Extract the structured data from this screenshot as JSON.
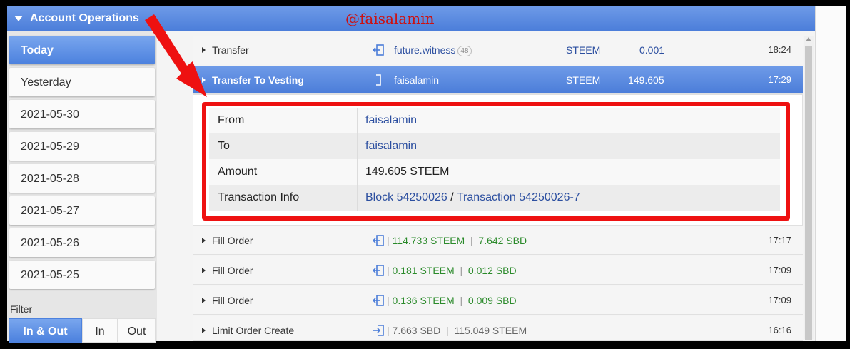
{
  "header": {
    "title": "Account Operations",
    "watermark": "@faisalamin"
  },
  "sidebar": {
    "days": [
      "Today",
      "Yesterday",
      "2021-05-30",
      "2021-05-29",
      "2021-05-28",
      "2021-05-27",
      "2021-05-26",
      "2021-05-25"
    ],
    "active_day": "Today",
    "filter_label": "Filter",
    "filter_options": [
      "In & Out",
      "In",
      "Out"
    ],
    "active_filter": "In & Out"
  },
  "operations": [
    {
      "type": "Transfer",
      "direction": "in",
      "party": "future.witness",
      "badge": "48",
      "asset": "STEEM",
      "amount": "0.001",
      "time": "18:24"
    },
    {
      "type": "Transfer To Vesting",
      "direction": "self",
      "party": "faisalamin",
      "asset": "STEEM",
      "amount": "149.605",
      "time": "17:29",
      "selected": true
    },
    {
      "type": "Fill Order",
      "direction": "in",
      "amount_a": "114.733 STEEM",
      "separator": "|",
      "amount_b": "7.642 SBD",
      "time": "17:17"
    },
    {
      "type": "Fill Order",
      "direction": "in",
      "amount_a": "0.181 STEEM",
      "separator": "|",
      "amount_b": "0.012 SBD",
      "time": "17:09"
    },
    {
      "type": "Fill Order",
      "direction": "in",
      "amount_a": "0.136 STEEM",
      "separator": "|",
      "amount_b": "0.009 SBD",
      "time": "17:09"
    },
    {
      "type": "Limit Order Create",
      "direction": "out",
      "separator": "|",
      "amount_a": "7.663 SBD",
      "amount_b": "115.049 STEEM",
      "time": "16:16"
    }
  ],
  "details": {
    "from_label": "From",
    "from_value": "faisalamin",
    "to_label": "To",
    "to_value": "faisalamin",
    "amount_label": "Amount",
    "amount_value": "149.605 STEEM",
    "tx_label": "Transaction Info",
    "block_link": "Block 54250026",
    "slash": "/",
    "tx_link": "Transaction 54250026-7"
  },
  "colors": {
    "accent": "#4b7dd9",
    "annotation_red": "#ee1111",
    "green": "#2a8a2a",
    "link": "#2c4fa0"
  }
}
